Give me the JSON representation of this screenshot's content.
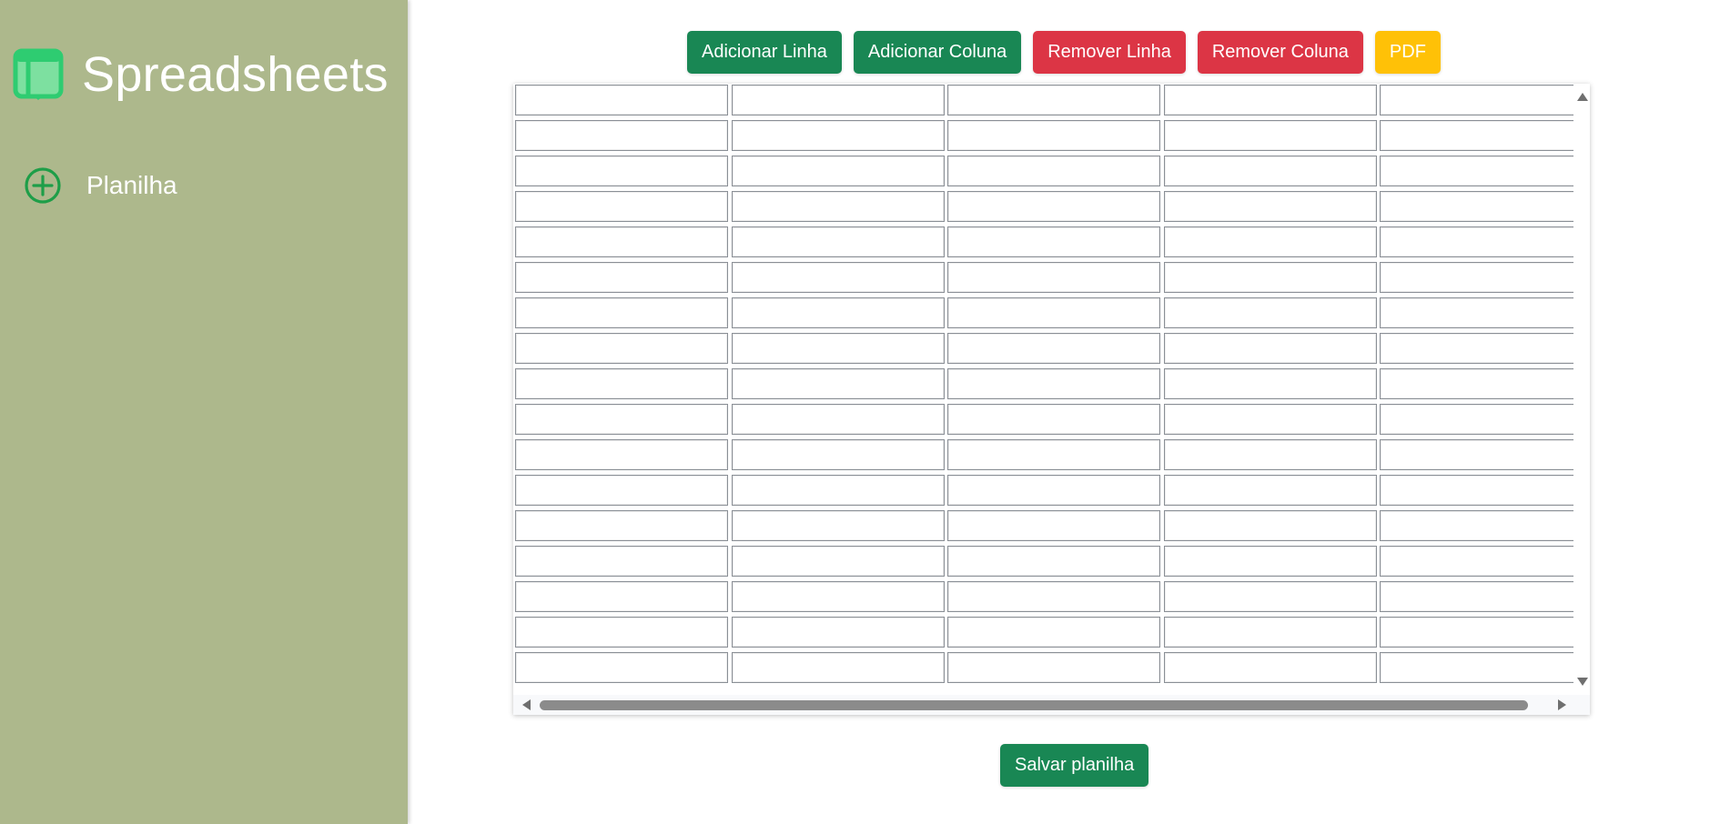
{
  "sidebar": {
    "brand_title": "Spreadsheets",
    "brand_icon": "spreadsheet-icon",
    "items": [
      {
        "label": "Planilha",
        "icon": "plus-circle-icon"
      }
    ],
    "background_color": "#adb88c"
  },
  "toolbar": {
    "add_row_label": "Adicionar Linha",
    "add_column_label": "Adicionar Coluna",
    "remove_row_label": "Remover Linha",
    "remove_column_label": "Remover Coluna",
    "pdf_label": "PDF"
  },
  "sheet": {
    "rows": 17,
    "columns": 5,
    "cells": [
      [
        "",
        "",
        "",
        "",
        ""
      ],
      [
        "",
        "",
        "",
        "",
        ""
      ],
      [
        "",
        "",
        "",
        "",
        ""
      ],
      [
        "",
        "",
        "",
        "",
        ""
      ],
      [
        "",
        "",
        "",
        "",
        ""
      ],
      [
        "",
        "",
        "",
        "",
        ""
      ],
      [
        "",
        "",
        "",
        "",
        ""
      ],
      [
        "",
        "",
        "",
        "",
        ""
      ],
      [
        "",
        "",
        "",
        "",
        ""
      ],
      [
        "",
        "",
        "",
        "",
        ""
      ],
      [
        "",
        "",
        "",
        "",
        ""
      ],
      [
        "",
        "",
        "",
        "",
        ""
      ],
      [
        "",
        "",
        "",
        "",
        ""
      ],
      [
        "",
        "",
        "",
        "",
        ""
      ],
      [
        "",
        "",
        "",
        "",
        ""
      ],
      [
        "",
        "",
        "",
        "",
        ""
      ],
      [
        "",
        "",
        "",
        "",
        ""
      ]
    ]
  },
  "footer": {
    "save_label": "Salvar planilha"
  },
  "colors": {
    "green": "#198754",
    "red": "#dc3545",
    "yellow": "#ffc107",
    "icon_green": "#2ecc71"
  }
}
